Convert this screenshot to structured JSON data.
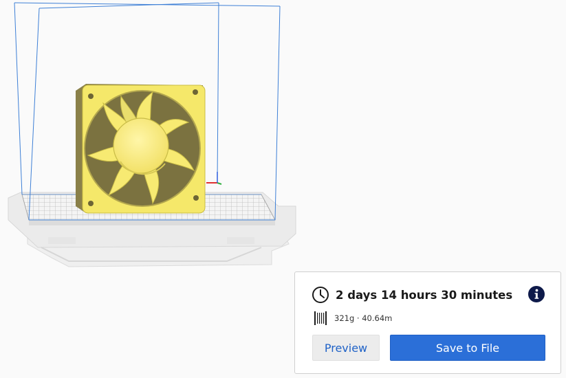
{
  "print_info": {
    "time_label": "2 days 14 hours 30 minutes",
    "material_label": "321g · 40.64m"
  },
  "actions": {
    "preview_label": "Preview",
    "save_label": "Save to File"
  },
  "icons": {
    "time": "clock-icon",
    "info": "info-icon",
    "material": "filament-spool-icon"
  },
  "colors": {
    "model": "#f5e86a",
    "build_volume": "#3d7fd6",
    "primary_button": "#2b6fd8",
    "link_text": "#1f62c7"
  }
}
